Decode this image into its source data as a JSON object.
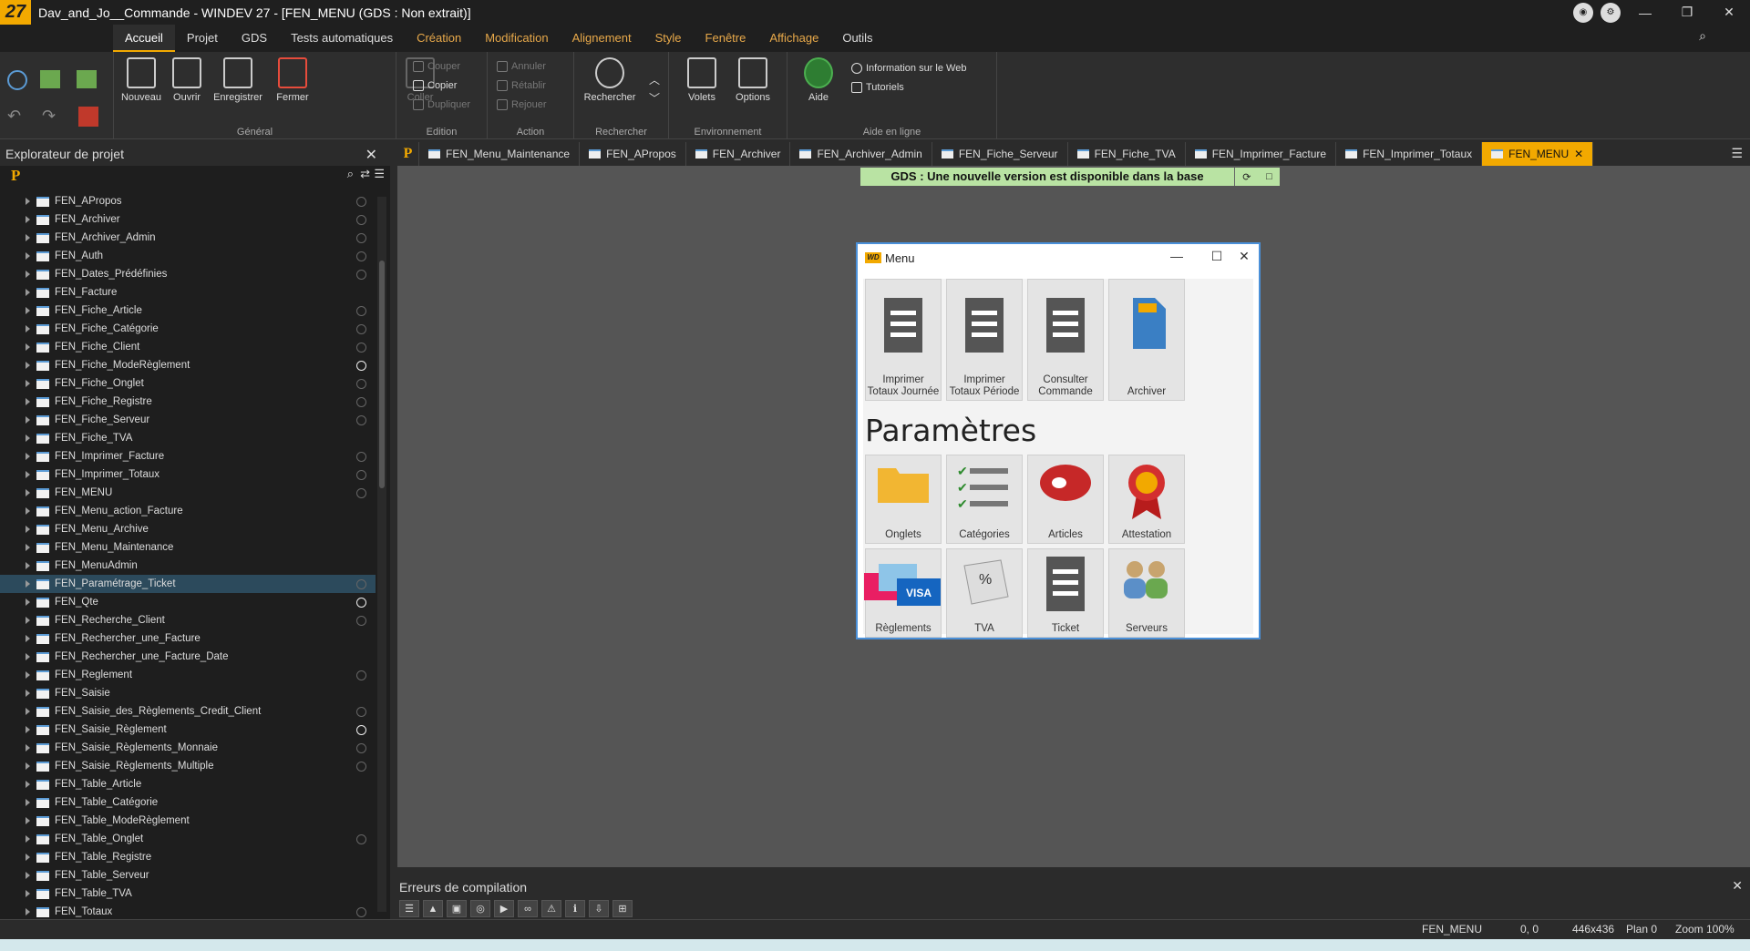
{
  "window": {
    "title": "Dav_and_Jo__Commande - WINDEV 27 - [FEN_MENU (GDS : Non extrait)]",
    "logo": "27"
  },
  "menu_tabs": [
    "Accueil",
    "Projet",
    "GDS",
    "Tests automatiques",
    "Création",
    "Modification",
    "Alignement",
    "Style",
    "Fenêtre",
    "Affichage",
    "Outils"
  ],
  "ribbon": {
    "nouveau": "Nouveau",
    "ouvrir": "Ouvrir",
    "enregistrer": "Enregistrer",
    "fermer": "Fermer",
    "general": "Général",
    "coller": "Coller",
    "couper": "Couper",
    "copier": "Copier",
    "dupliquer": "Dupliquer",
    "edition": "Edition",
    "annuler": "Annuler",
    "retablir": "Rétablir",
    "rejouer": "Rejouer",
    "action": "Action",
    "rechercher": "Rechercher",
    "rechercher_group": "Rechercher",
    "volets": "Volets",
    "options": "Options",
    "environnement": "Environnement",
    "aide": "Aide",
    "info_web": "Information sur le Web",
    "tutoriels": "Tutoriels",
    "aide_en_ligne": "Aide en ligne"
  },
  "explorer": {
    "title": "Explorateur de projet",
    "items": [
      "FEN_APropos",
      "FEN_Archiver",
      "FEN_Archiver_Admin",
      "FEN_Auth",
      "FEN_Dates_Prédéfinies",
      "FEN_Facture",
      "FEN_Fiche_Article",
      "FEN_Fiche_Catégorie",
      "FEN_Fiche_Client",
      "FEN_Fiche_ModeRèglement",
      "FEN_Fiche_Onglet",
      "FEN_Fiche_Registre",
      "FEN_Fiche_Serveur",
      "FEN_Fiche_TVA",
      "FEN_Imprimer_Facture",
      "FEN_Imprimer_Totaux",
      "FEN_MENU",
      "FEN_Menu_action_Facture",
      "FEN_Menu_Archive",
      "FEN_Menu_Maintenance",
      "FEN_MenuAdmin",
      "FEN_Paramétrage_Ticket",
      "FEN_Qte",
      "FEN_Recherche_Client",
      "FEN_Rechercher_une_Facture",
      "FEN_Rechercher_une_Facture_Date",
      "FEN_Reglement",
      "FEN_Saisie",
      "FEN_Saisie_des_Règlements_Credit_Client",
      "FEN_Saisie_Règlement",
      "FEN_Saisie_Règlements_Monnaie",
      "FEN_Saisie_Règlements_Multiple",
      "FEN_Table_Article",
      "FEN_Table_Catégorie",
      "FEN_Table_ModeRèglement",
      "FEN_Table_Onglet",
      "FEN_Table_Registre",
      "FEN_Table_Serveur",
      "FEN_Table_TVA",
      "FEN_Totaux"
    ],
    "selected": "FEN_Paramétrage_Ticket"
  },
  "doc_tabs": [
    "FEN_Menu_Maintenance",
    "FEN_APropos",
    "FEN_Archiver",
    "FEN_Archiver_Admin",
    "FEN_Fiche_Serveur",
    "FEN_Fiche_TVA",
    "FEN_Imprimer_Facture",
    "FEN_Imprimer_Totaux",
    "FEN_MENU"
  ],
  "gds_banner": "GDS : Une nouvelle version est disponible dans la base",
  "menu_window": {
    "title": "Menu",
    "wd_logo": "WD",
    "top_tiles": [
      "Imprimer Totaux Journée",
      "Imprimer Totaux Période",
      "Consulter Commande",
      "Archiver"
    ],
    "section": "Paramètres",
    "param_tiles": [
      "Onglets",
      "Catégories",
      "Articles",
      "Attestation"
    ],
    "bottom_tiles": [
      "Règlements",
      "TVA",
      "Ticket",
      "Serveurs"
    ]
  },
  "errors_panel": {
    "title": "Erreurs de compilation"
  },
  "status": {
    "window": "FEN_MENU",
    "pos": "0, 0",
    "size": "446x436",
    "plan": "Plan 0",
    "zoom": "Zoom 100%"
  }
}
